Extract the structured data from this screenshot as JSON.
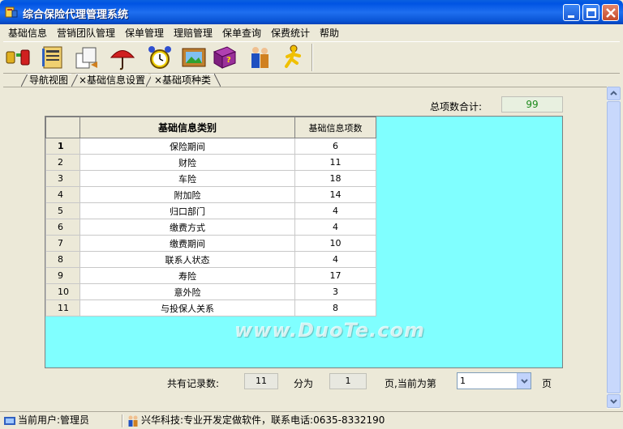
{
  "window": {
    "title": "综合保险代理管理系统"
  },
  "menu": [
    "基础信息",
    "营销团队管理",
    "保单管理",
    "理赔管理",
    "保单查询",
    "保费统计",
    "帮助"
  ],
  "toolbar": {
    "icons": [
      "user-switch-icon",
      "contacts-icon",
      "files-icon",
      "umbrella-icon",
      "alarm-clock-icon",
      "picture-icon",
      "help-book-icon",
      "users-icon",
      "running-man-icon"
    ]
  },
  "tabs": [
    {
      "label": "导航视图"
    },
    {
      "label": "×基础信息设置"
    },
    {
      "label": "×基础项种类"
    }
  ],
  "summary": {
    "total_label": "总项数合计:",
    "total_value": "99"
  },
  "grid": {
    "headers": [
      "",
      "基础信息类别",
      "基础信息项数"
    ],
    "rows": [
      {
        "index": "1",
        "category": "保险期间",
        "count": "6"
      },
      {
        "index": "2",
        "category": "财险",
        "count": "11"
      },
      {
        "index": "3",
        "category": "车险",
        "count": "18"
      },
      {
        "index": "4",
        "category": "附加险",
        "count": "14"
      },
      {
        "index": "5",
        "category": "归口部门",
        "count": "4"
      },
      {
        "index": "6",
        "category": "缴费方式",
        "count": "4"
      },
      {
        "index": "7",
        "category": "缴费期间",
        "count": "10"
      },
      {
        "index": "8",
        "category": "联系人状态",
        "count": "4"
      },
      {
        "index": "9",
        "category": "寿险",
        "count": "17"
      },
      {
        "index": "10",
        "category": "意外险",
        "count": "3"
      },
      {
        "index": "11",
        "category": "与投保人关系",
        "count": "8"
      }
    ]
  },
  "pager": {
    "records_label": "共有记录数:",
    "records_value": "11",
    "split_label": "分为",
    "pages_value": "1",
    "current_label": "页,当前为第",
    "current_value": "1",
    "page_suffix": "页"
  },
  "status": {
    "user": "当前用户:管理员",
    "company": "兴华科技:专业开发定做软件，联系电话:0635-8332190"
  },
  "watermark": "www.DuoTe.com",
  "colors": {
    "titlebar": "#0054e3",
    "grid_bg": "#80ffff",
    "total_text": "#1a8a1a"
  }
}
